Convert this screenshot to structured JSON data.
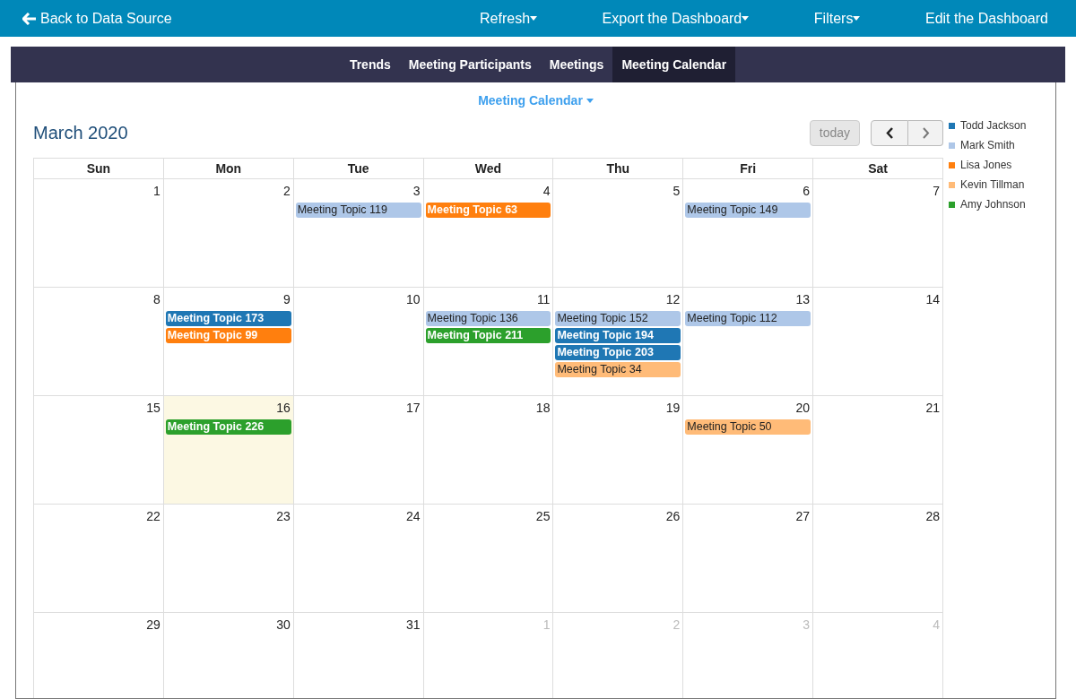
{
  "top_bar": {
    "back": "Back to Data Source",
    "menus": [
      {
        "label": "Refresh",
        "dropdown": true
      },
      {
        "label": "Export the Dashboard",
        "dropdown": true
      },
      {
        "label": "Filters",
        "dropdown": true
      },
      {
        "label": "Edit the Dashboard",
        "dropdown": false
      }
    ]
  },
  "tabs": [
    {
      "label": "Trends",
      "selected": false
    },
    {
      "label": "Meeting Participants",
      "selected": false
    },
    {
      "label": "Meetings",
      "selected": false
    },
    {
      "label": "Meeting Calendar",
      "selected": true
    }
  ],
  "panel_title": "Meeting Calendar",
  "calendar": {
    "title": "March 2020",
    "today_button": "today",
    "weekdays": [
      "Sun",
      "Mon",
      "Tue",
      "Wed",
      "Thu",
      "Fri",
      "Sat"
    ],
    "weeks": [
      [
        {
          "day": "1",
          "other_month": false,
          "today": false
        },
        {
          "day": "2",
          "other_month": false,
          "today": false
        },
        {
          "day": "3",
          "other_month": false,
          "today": false,
          "events": [
            {
              "title": "Meeting Topic 119",
              "color": "#aec7e8"
            }
          ]
        },
        {
          "day": "4",
          "other_month": false,
          "today": false,
          "events": [
            {
              "title": "Meeting Topic 63",
              "color": "#ff7f0e"
            }
          ]
        },
        {
          "day": "5",
          "other_month": false,
          "today": false
        },
        {
          "day": "6",
          "other_month": false,
          "today": false,
          "events": [
            {
              "title": "Meeting Topic 149",
              "color": "#aec7e8"
            }
          ]
        },
        {
          "day": "7",
          "other_month": false,
          "today": false
        }
      ],
      [
        {
          "day": "8",
          "other_month": false,
          "today": false
        },
        {
          "day": "9",
          "other_month": false,
          "today": false,
          "events": [
            {
              "title": "Meeting Topic 173",
              "color": "#1f77b4"
            },
            {
              "title": "Meeting Topic 99",
              "color": "#ff7f0e"
            }
          ]
        },
        {
          "day": "10",
          "other_month": false,
          "today": false
        },
        {
          "day": "11",
          "other_month": false,
          "today": false,
          "events": [
            {
              "title": "Meeting Topic 136",
              "color": "#aec7e8"
            },
            {
              "title": "Meeting Topic 211",
              "color": "#2ca02c"
            }
          ]
        },
        {
          "day": "12",
          "other_month": false,
          "today": false,
          "events": [
            {
              "title": "Meeting Topic 152",
              "color": "#aec7e8"
            },
            {
              "title": "Meeting Topic 194",
              "color": "#1f77b4"
            },
            {
              "title": "Meeting Topic 203",
              "color": "#1f77b4"
            },
            {
              "title": "Meeting Topic 34",
              "color": "#ffbb78"
            }
          ]
        },
        {
          "day": "13",
          "other_month": false,
          "today": false,
          "events": [
            {
              "title": "Meeting Topic 112",
              "color": "#aec7e8"
            }
          ]
        },
        {
          "day": "14",
          "other_month": false,
          "today": false
        }
      ],
      [
        {
          "day": "15",
          "other_month": false,
          "today": false
        },
        {
          "day": "16",
          "other_month": false,
          "today": true,
          "events": [
            {
              "title": "Meeting Topic 226",
              "color": "#2ca02c"
            }
          ]
        },
        {
          "day": "17",
          "other_month": false,
          "today": false
        },
        {
          "day": "18",
          "other_month": false,
          "today": false
        },
        {
          "day": "19",
          "other_month": false,
          "today": false
        },
        {
          "day": "20",
          "other_month": false,
          "today": false,
          "events": [
            {
              "title": "Meeting Topic 50",
              "color": "#ffbb78"
            }
          ]
        },
        {
          "day": "21",
          "other_month": false,
          "today": false
        }
      ],
      [
        {
          "day": "22",
          "other_month": false,
          "today": false
        },
        {
          "day": "23",
          "other_month": false,
          "today": false
        },
        {
          "day": "24",
          "other_month": false,
          "today": false
        },
        {
          "day": "25",
          "other_month": false,
          "today": false
        },
        {
          "day": "26",
          "other_month": false,
          "today": false
        },
        {
          "day": "27",
          "other_month": false,
          "today": false
        },
        {
          "day": "28",
          "other_month": false,
          "today": false
        }
      ],
      [
        {
          "day": "29",
          "other_month": false,
          "today": false
        },
        {
          "day": "30",
          "other_month": false,
          "today": false
        },
        {
          "day": "31",
          "other_month": false,
          "today": false
        },
        {
          "day": "1",
          "other_month": true,
          "today": false
        },
        {
          "day": "2",
          "other_month": true,
          "today": false
        },
        {
          "day": "3",
          "other_month": true,
          "today": false
        },
        {
          "day": "4",
          "other_month": true,
          "today": false
        }
      ]
    ]
  },
  "legend": [
    {
      "name": "Todd Jackson",
      "color": "#1f77b4"
    },
    {
      "name": "Mark Smith",
      "color": "#aec7e8"
    },
    {
      "name": "Lisa Jones",
      "color": "#ff7f0e"
    },
    {
      "name": "Kevin Tillman",
      "color": "#ffbb78"
    },
    {
      "name": "Amy Johnson",
      "color": "#2ca02c"
    }
  ]
}
